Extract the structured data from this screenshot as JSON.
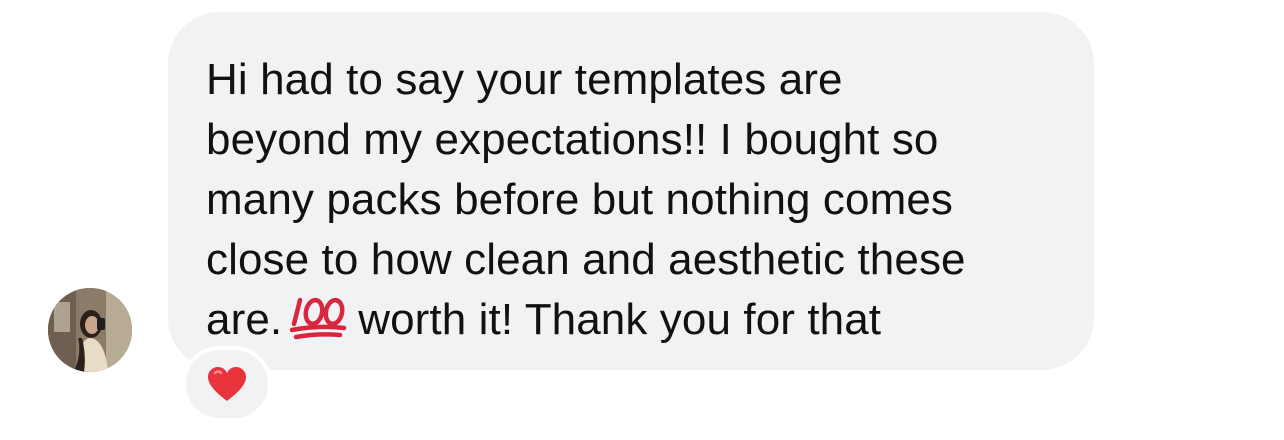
{
  "message": {
    "lines": [
      "Hi had to say your templates are",
      "beyond my expectations!! I bought so",
      "many packs before but nothing comes",
      "close to how clean and aesthetic these"
    ],
    "last_line_before_emoji": "are.",
    "last_line_emoji": "hundred-points-icon",
    "last_line_after_emoji": "worth it! Thank you for that"
  },
  "reaction": {
    "icon": "red-heart-icon"
  },
  "sender": {
    "avatar": "profile-photo"
  },
  "colors": {
    "bubble": "#f2f2f5",
    "text": "#111111",
    "heart": "#e8323c",
    "hundred": "#d7263d"
  }
}
